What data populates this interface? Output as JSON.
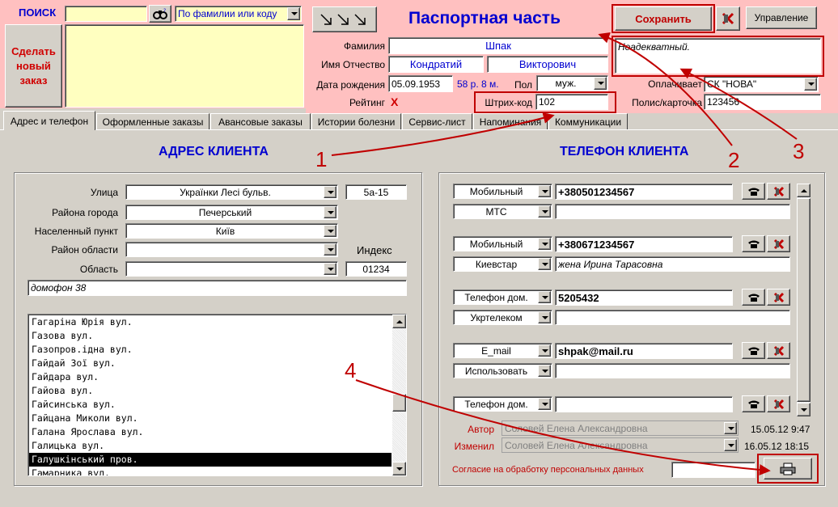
{
  "search": {
    "label": "ПОИСК",
    "input_value": "",
    "mode_select": "По фамилии или коду",
    "new_order_label": "Сделать новый заказ"
  },
  "header": {
    "title": "Паспортная часть",
    "save_label": "Сохранить",
    "manage_label": "Управление",
    "surname_label": "Фамилия",
    "surname": "Шпак",
    "name_label": "Имя Отчество",
    "first_name": "Кондратий",
    "patronymic": "Викторович",
    "dob_label": "Дата рождения",
    "dob": "05.09.1953",
    "age": "58 р. 8 м.",
    "sex_label": "Пол",
    "sex": "муж.",
    "rating_label": "Рейтинг",
    "rating": "X",
    "barcode_label": "Штрих-код",
    "barcode": "102",
    "note": "Неадекватный.",
    "payer_label": "Оплачивает",
    "payer": "СК \"НОВА\"",
    "policy_label": "Полис/карточка",
    "policy": "123456"
  },
  "tabs": [
    {
      "label": "Адрес и телефон"
    },
    {
      "label": "Оформленные заказы"
    },
    {
      "label": "Авансовые заказы"
    },
    {
      "label": "Истории болезни"
    },
    {
      "label": "Сервис-лист"
    },
    {
      "label": "Напоминания"
    },
    {
      "label": "Коммуникации"
    }
  ],
  "address": {
    "title": "АДРЕС КЛИЕНТА",
    "street_label": "Улица",
    "street": "Українки Лесі бульв.",
    "house": "5а-15",
    "district_label": "Района города",
    "district": "Печерський",
    "locality_label": "Населенный пункт",
    "locality": "Київ",
    "region_district_label": "Район области",
    "region_district": "",
    "index_label": "Индекс",
    "region_label": "Область",
    "region": "",
    "index": "01234",
    "note": "домофон 38",
    "streets": [
      "Гагаріна Юрія вул.",
      "Газова вул.",
      "Газопров.ідна вул.",
      "Гайдай Зої вул.",
      "Гайдара вул.",
      "Гайова вул.",
      "Гайсинська вул.",
      "Гайцана Миколи вул.",
      "Галана Ярослава вул.",
      "Галицька вул.",
      "Галушкінський пров.",
      "Гамарника вул."
    ],
    "selected_street_index": 10
  },
  "phones": {
    "title": "ТЕЛЕФОН КЛИЕНТА",
    "entries": [
      {
        "type": "Мобильный",
        "value": "+380501234567",
        "operator": "МТС",
        "comment": ""
      },
      {
        "type": "Мобильный",
        "value": "+380671234567",
        "operator": "Киевстар",
        "comment": "жена Ирина Тарасовна"
      },
      {
        "type": "Телефон дом.",
        "value": "5205432",
        "operator": "Укртелеком",
        "comment": ""
      },
      {
        "type": "E_mail",
        "value": "shpak@mail.ru",
        "operator": "Использовать",
        "comment": ""
      },
      {
        "type": "Телефон дом.",
        "value": "",
        "operator": "",
        "comment": ""
      }
    ],
    "author_label": "Автор",
    "author": "Соловей Елена Александровна",
    "author_date": "15.05.12 9:47",
    "changed_label": "Изменил",
    "changed_by": "Соловей Елена Александровна",
    "changed_date": "16.05.12 18:15",
    "consent_label": "Согласие на обработку персональных данных",
    "consent_value": ""
  },
  "annotations": [
    "1",
    "2",
    "3",
    "4"
  ],
  "colors": {
    "header_bg": "#ffc0c0",
    "accent_blue": "#0000d0",
    "annotation_red": "#c00000",
    "window_bg": "#d4d0c8"
  }
}
